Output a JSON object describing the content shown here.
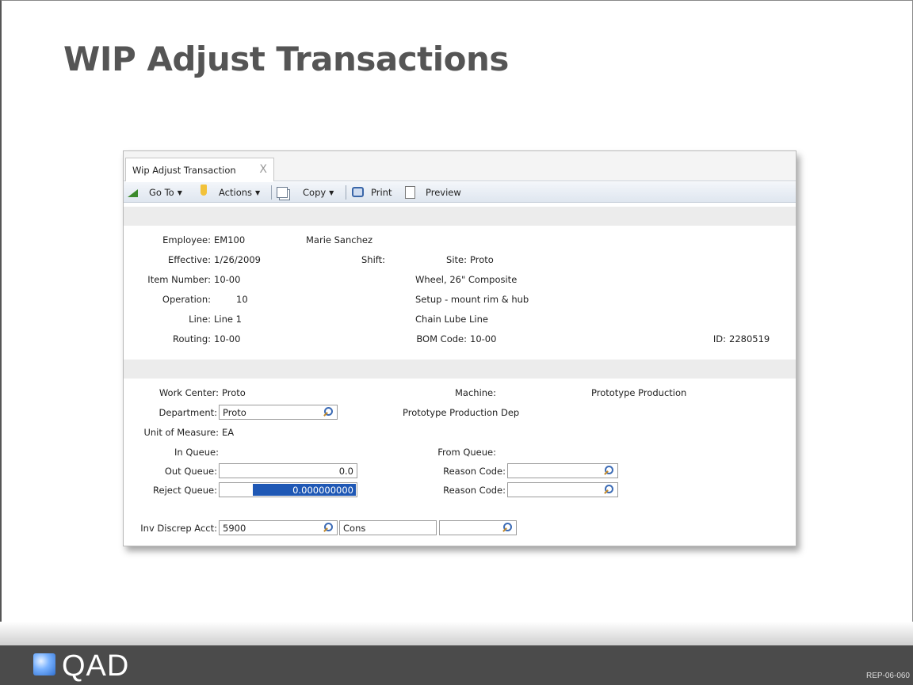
{
  "slide": {
    "title": "WIP Adjust Transactions",
    "logo_text": "QAD",
    "reference": "REP-06-060"
  },
  "window": {
    "tab_label": "Wip Adjust Transaction",
    "tab_close": "X",
    "toolbar": {
      "goto": "Go To",
      "actions": "Actions",
      "copy": "Copy",
      "print": "Print",
      "preview": "Preview"
    }
  },
  "header": {
    "employee_label": "Employee:",
    "employee_value": "EM100",
    "employee_name": "Marie Sanchez",
    "effective_label": "Effective:",
    "effective_value": "1/26/2009",
    "shift_label": "Shift:",
    "site_label": "Site:",
    "site_value": "Proto",
    "item_label": "Item Number:",
    "item_value": "10-00",
    "item_desc": "Wheel, 26\" Composite",
    "operation_label": "Operation:",
    "operation_value": "10",
    "operation_desc": "Setup - mount rim & hub",
    "line_label": "Line:",
    "line_value": "Line 1",
    "line_desc": "Chain Lube Line",
    "routing_label": "Routing:",
    "routing_value": "10-00",
    "bom_label": "BOM Code:",
    "bom_value": "10-00",
    "id_label": "ID:",
    "id_value": "2280519"
  },
  "detail": {
    "workcenter_label": "Work Center:",
    "workcenter_value": "Proto",
    "machine_label": "Machine:",
    "machine_desc": "Prototype Production",
    "department_label": "Department:",
    "department_value": "Proto",
    "department_desc": "Prototype Production Dep",
    "uom_label": "Unit of Measure:",
    "uom_value": "EA",
    "inqueue_label": "In Queue:",
    "fromqueue_label": "From Queue:",
    "outqueue_label": "Out Queue:",
    "outqueue_value": "0.0",
    "reason1_label": "Reason Code:",
    "rejectqueue_label": "Reject Queue:",
    "rejectqueue_value": "0.000000000",
    "reason2_label": "Reason Code:",
    "invdiscrep_label": "Inv Discrep Acct:",
    "invdiscrep_value": "5900",
    "invdiscrep_sub": "Cons",
    "invdiscrep_cc": ""
  }
}
